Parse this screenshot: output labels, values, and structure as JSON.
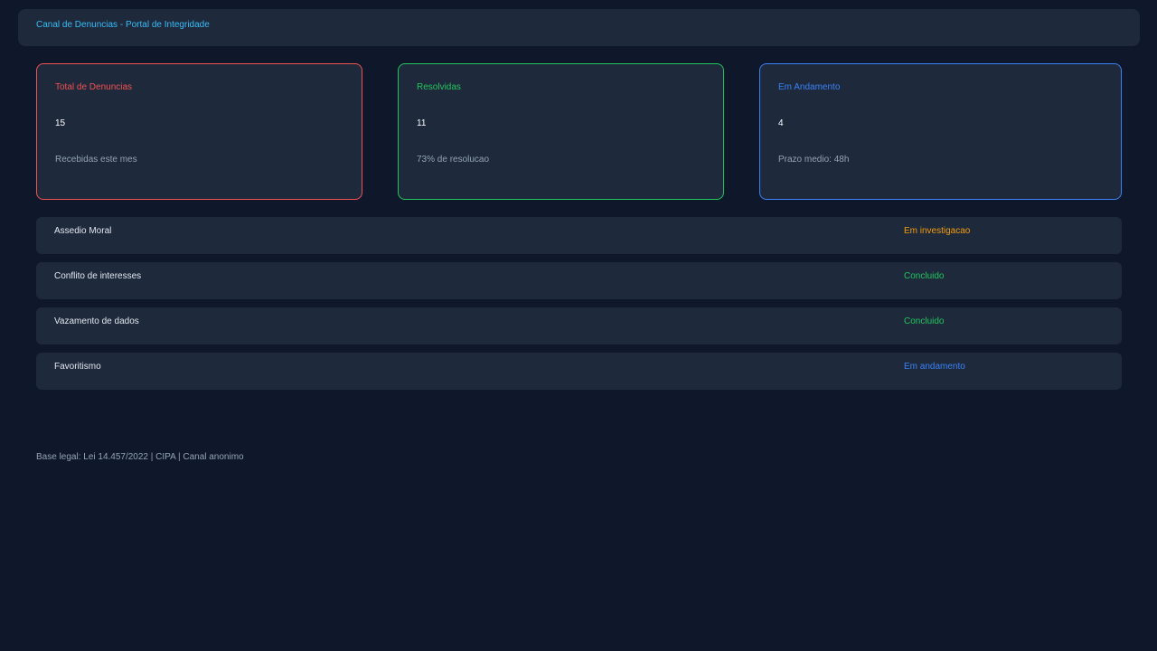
{
  "header": {
    "title": "Canal de Denuncias - Portal de Integridade"
  },
  "cards": [
    {
      "label": "Total de Denuncias",
      "value": "15",
      "subtitle": "Recebidas este mes",
      "color": "#f05252"
    },
    {
      "label": "Resolvidas",
      "value": "11",
      "subtitle": "73% de resolucao",
      "color": "#22c55e"
    },
    {
      "label": "Em Andamento",
      "value": "4",
      "subtitle": "Prazo medio: 48h",
      "color": "#3b82f6"
    }
  ],
  "reports": [
    {
      "title": "Assedio Moral",
      "status": "Em investigacao",
      "status_color": "#f59e0b"
    },
    {
      "title": "Conflito de interesses",
      "status": "Concluido",
      "status_color": "#22c55e"
    },
    {
      "title": "Vazamento de dados",
      "status": "Concluido",
      "status_color": "#22c55e"
    },
    {
      "title": "Favoritismo",
      "status": "Em andamento",
      "status_color": "#3b82f6"
    }
  ],
  "footer": {
    "text": "Base legal: Lei 14.457/2022 | CIPA | Canal anonimo"
  },
  "colors": {
    "background": "#0f172a",
    "panel": "#1e293b",
    "accent": "#38bdf8"
  }
}
